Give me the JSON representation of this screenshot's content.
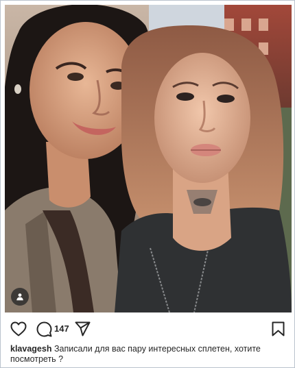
{
  "post": {
    "image_alt": "Selfie of two women",
    "comment_count": "147",
    "username": "klavagesh",
    "caption_text": "Записали для вас пару интересных сплетен, хотите посмотреть ?"
  },
  "icons": {
    "tag": "user-tag-icon",
    "like": "heart-icon",
    "comment": "comment-bubble-icon",
    "share": "paper-plane-icon",
    "save": "bookmark-icon"
  },
  "colors": {
    "text": "#262626",
    "frame_border": "#b9c2cc"
  }
}
